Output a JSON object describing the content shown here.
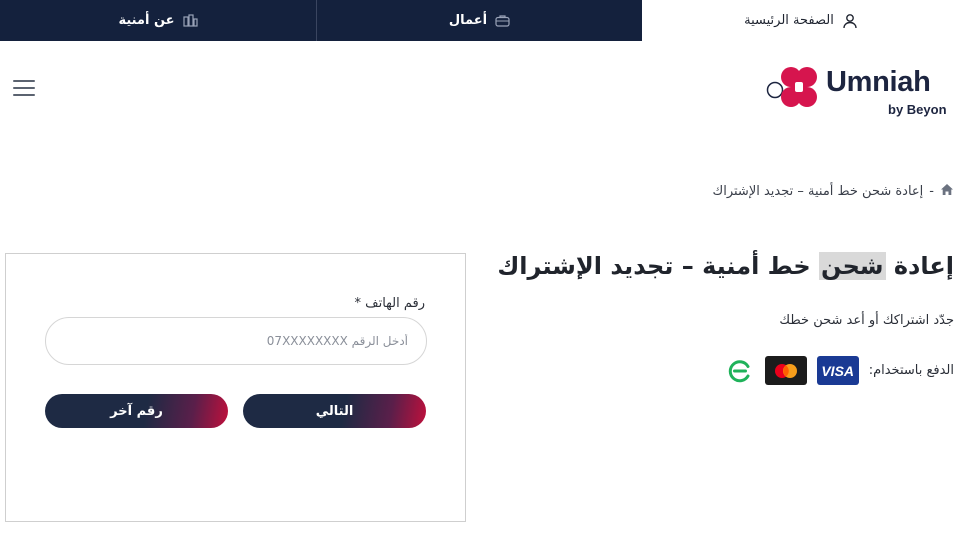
{
  "topbar": {
    "about_label": "عن أمنية",
    "about_icon": "building-icon",
    "business_label": "أعمال",
    "business_icon": "briefcase-icon",
    "home_label": "الصفحة الرئيسية",
    "home_icon": "user-icon"
  },
  "header": {
    "logo_word": "Umniah",
    "logo_sub": "by Beyon",
    "menu_icon": "hamburger-icon",
    "brand_color": "#d6154e",
    "navy_color": "#14213d"
  },
  "breadcrumb": {
    "home_icon": "home-icon",
    "separator": "-",
    "current": "إعادة شحن خط أمنية – تجديد الإشتراك"
  },
  "main": {
    "title_part1": "إعادة ",
    "title_highlight": "شحن",
    "title_part2": " خط أمنية – تجديد الإشتراك",
    "subtitle": "جدّد اشتراكك أو أعد شحن خطك",
    "payment_label": "الدفع باستخدام:",
    "cards": [
      "VISA",
      "mastercard",
      "efawateercom"
    ]
  },
  "form": {
    "phone_label": "رقم الهاتف *",
    "phone_placeholder": "أدخل الرقم 07XXXXXXXX",
    "phone_value": "",
    "next_label": "التالي",
    "other_number_label": "رقم آخر"
  }
}
